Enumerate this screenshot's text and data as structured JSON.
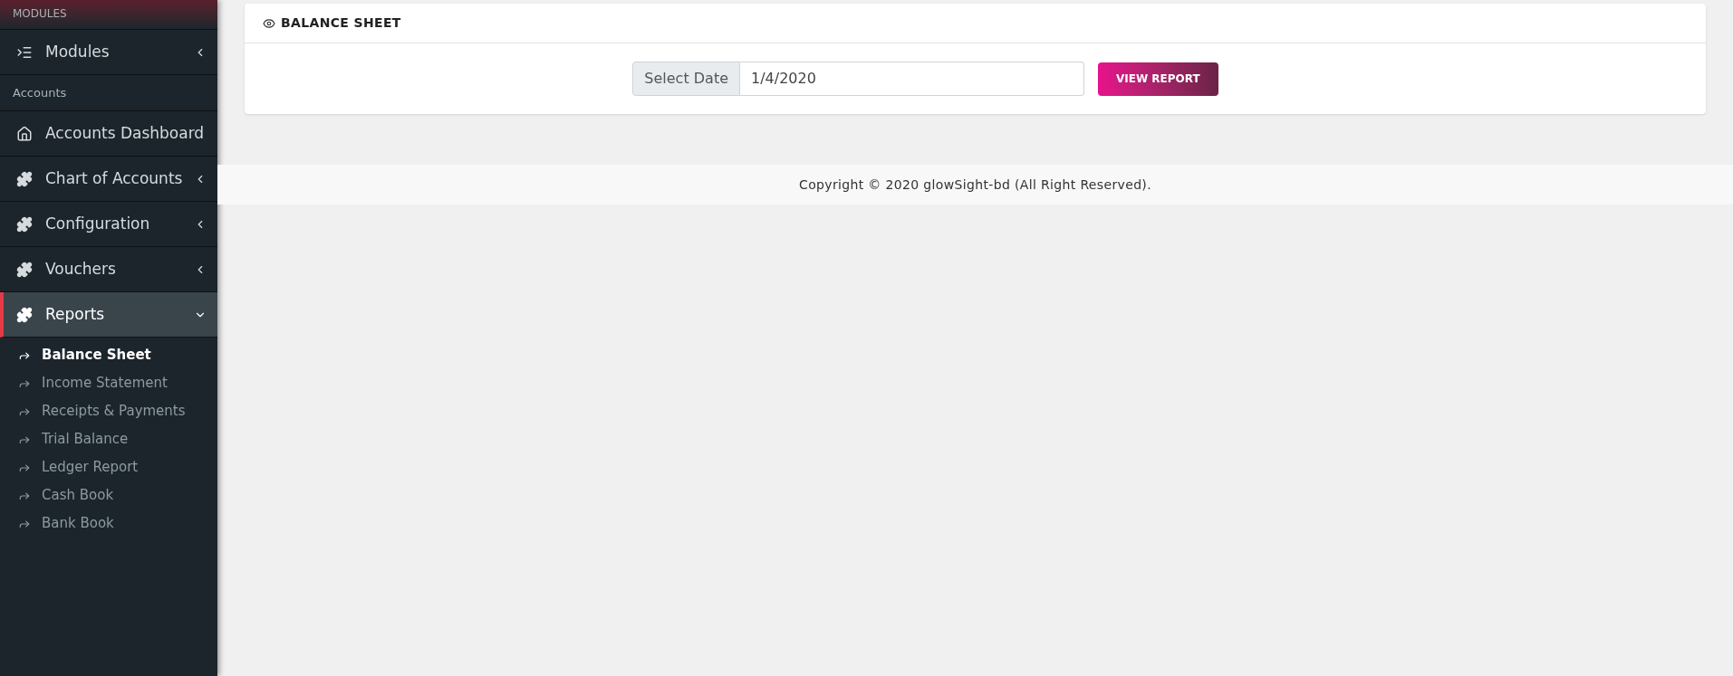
{
  "sidebar": {
    "top_label": "MODULES",
    "sections": [
      {
        "items": [
          {
            "label": "Modules",
            "kind": "list",
            "expanded": false,
            "selected": false
          }
        ]
      },
      {
        "heading": "Accounts",
        "items": [
          {
            "label": "Accounts Dashboard",
            "kind": "home",
            "selected": false
          },
          {
            "label": "Chart of Accounts",
            "kind": "module",
            "expanded": false,
            "selected": false
          },
          {
            "label": "Configuration",
            "kind": "module",
            "expanded": false,
            "selected": false
          },
          {
            "label": "Vouchers",
            "kind": "module",
            "expanded": false,
            "selected": false
          },
          {
            "label": "Reports",
            "kind": "module",
            "expanded": true,
            "selected": true,
            "children": [
              {
                "label": "Balance Sheet",
                "selected": true
              },
              {
                "label": "Income Statement",
                "selected": false
              },
              {
                "label": "Receipts & Payments",
                "selected": false
              },
              {
                "label": "Trial Balance",
                "selected": false
              },
              {
                "label": "Ledger Report",
                "selected": false
              },
              {
                "label": "Cash Book",
                "selected": false
              },
              {
                "label": "Bank Book",
                "selected": false
              }
            ]
          }
        ]
      }
    ]
  },
  "card": {
    "title": "BALANCE SHEET",
    "date_label": "Select Date",
    "date_value": "1/4/2020",
    "button": "VIEW REPORT"
  },
  "footer": "Copyright © 2020 glowSight-bd (All Right Reserved)."
}
